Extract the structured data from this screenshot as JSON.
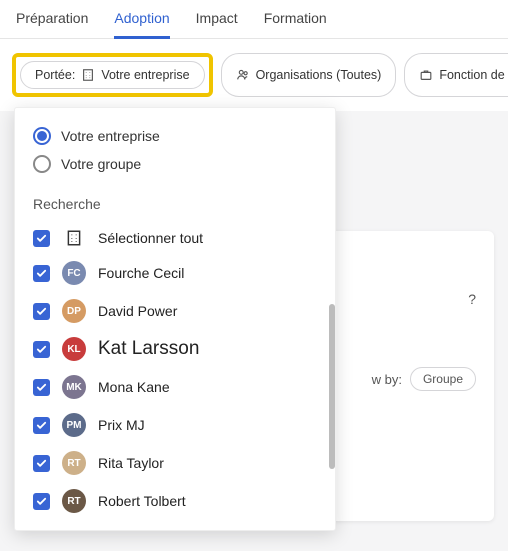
{
  "tabs": {
    "preparation": "Préparation",
    "adoption": "Adoption",
    "impact": "Impact",
    "formation": "Formation"
  },
  "filters": {
    "scope_prefix": "Portée:",
    "scope_value": "Votre entreprise",
    "organisations": "Organisations (Toutes)",
    "job_function": "Fonction de travail (Tous)"
  },
  "dropdown": {
    "radio_enterprise": "Votre entreprise",
    "radio_group": "Votre groupe",
    "search_label": "Recherche",
    "select_all": "Sélectionner tout",
    "people": [
      {
        "name": "Fourche Cecil",
        "color": "#7a8ab0"
      },
      {
        "name": "David Power",
        "color": "#d59b63"
      },
      {
        "name": "Kat Larsson",
        "color": "#c83c3c",
        "emphasis": true
      },
      {
        "name": "Mona Kane",
        "color": "#7c7590"
      },
      {
        "name": "Prix MJ",
        "color": "#5c6b8a"
      },
      {
        "name": "Rita Taylor",
        "color": "#cdb089"
      },
      {
        "name": "Robert Tolbert",
        "color": "#6b5846"
      }
    ]
  },
  "background": {
    "question_tail": "?",
    "view_by_label": "w by:",
    "view_by_value": "Groupe"
  }
}
